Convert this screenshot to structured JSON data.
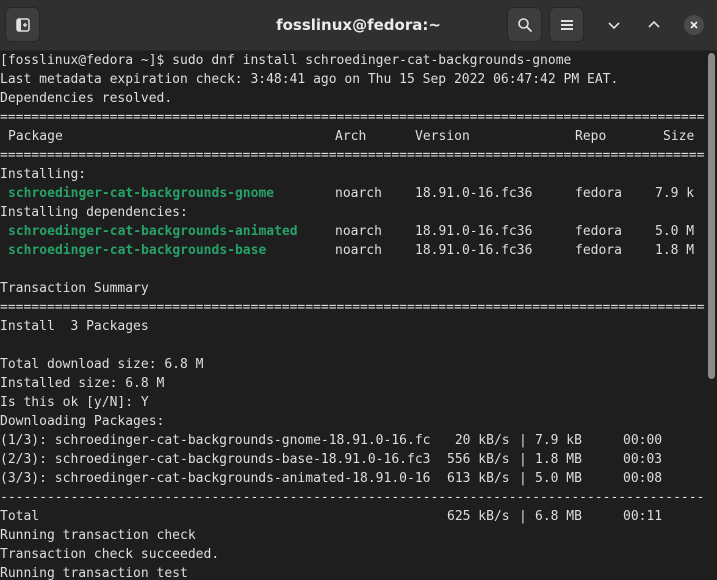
{
  "window": {
    "title": "fosslinux@fedora:~",
    "new_tab_icon": "new-tab-icon",
    "search_icon": "search-icon",
    "menu_icon": "hamburger-menu-icon",
    "minimize_icon": "chevron-down-icon",
    "maximize_icon": "chevron-up-icon",
    "close_icon": "close-icon"
  },
  "colors": {
    "background": "#1e1e1e",
    "titlebar": "#303030",
    "text": "#dedede",
    "package_green": "#26a269"
  },
  "terminal": {
    "prompt": "[fosslinux@fedora ~]$ sudo dnf install schroedinger-cat-backgrounds-gnome",
    "metadata": "Last metadata expiration check: 3:48:41 ago on Thu 15 Sep 2022 06:47:42 PM EAT.",
    "deps_resolved": "Dependencies resolved.",
    "separator_eq": "================================================================================================",
    "separator_dash": "------------------------------------------------------------------------------------------------",
    "table_header": {
      "package": "Package",
      "arch": "Arch",
      "version": "Version",
      "repo": "Repo",
      "size": "Size"
    },
    "installing_label": "Installing:",
    "installing_deps_label": "Installing dependencies:",
    "packages": [
      {
        "name": "schroedinger-cat-backgrounds-gnome",
        "arch": "noarch",
        "version": "18.91.0-16.fc36",
        "repo": "fedora",
        "size": "7.9 k"
      },
      {
        "name": "schroedinger-cat-backgrounds-animated",
        "arch": "noarch",
        "version": "18.91.0-16.fc36",
        "repo": "fedora",
        "size": "5.0 M"
      },
      {
        "name": "schroedinger-cat-backgrounds-base",
        "arch": "noarch",
        "version": "18.91.0-16.fc36",
        "repo": "fedora",
        "size": "1.8 M"
      }
    ],
    "transaction_summary": "Transaction Summary",
    "install_count": "Install  3 Packages",
    "total_download": "Total download size: 6.8 M",
    "installed_size": "Installed size: 6.8 M",
    "confirm": "Is this ok [y/N]: Y",
    "downloading": "Downloading Packages:",
    "downloads": [
      {
        "file": "(1/3): schroedinger-cat-backgrounds-gnome-18.91.0-16.fc",
        "rate": " 20 kB/s",
        "size": "7.9 kB",
        "time": "00:00"
      },
      {
        "file": "(2/3): schroedinger-cat-backgrounds-base-18.91.0-16.fc3",
        "rate": "556 kB/s",
        "size": "1.8 MB",
        "time": "00:03"
      },
      {
        "file": "(3/3): schroedinger-cat-backgrounds-animated-18.91.0-16",
        "rate": "613 kB/s",
        "size": "5.0 MB",
        "time": "00:08"
      }
    ],
    "total": {
      "label": "Total",
      "rate": "625 kB/s",
      "size": "6.8 MB",
      "time": "00:11"
    },
    "running_check": "Running transaction check",
    "check_succeeded": "Transaction check succeeded.",
    "running_test": "Running transaction test"
  }
}
